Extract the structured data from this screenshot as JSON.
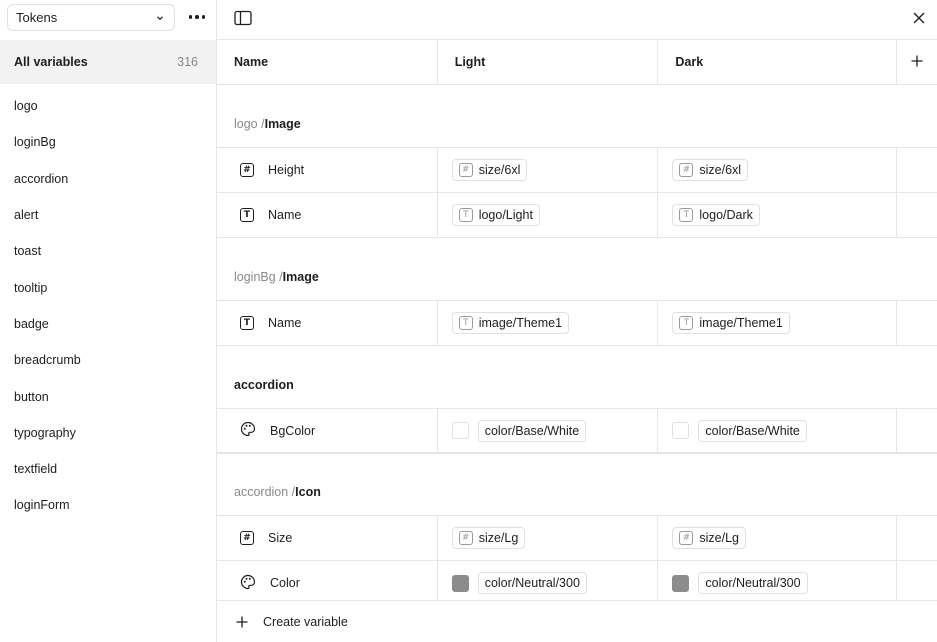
{
  "sidebar": {
    "collection": "Tokens",
    "all_variables": {
      "label": "All variables",
      "count": "316"
    },
    "groups": [
      "logo",
      "loginBg",
      "accordion",
      "alert",
      "toast",
      "tooltip",
      "badge",
      "breadcrumb",
      "button",
      "typography",
      "textfield",
      "loginForm"
    ]
  },
  "table": {
    "headers": {
      "name": "Name",
      "light": "Light",
      "dark": "Dark"
    },
    "sections": [
      {
        "path": "logo / ",
        "leaf": "Image",
        "rows": [
          {
            "type": "number",
            "name": "Height",
            "light": "size/6xl",
            "dark": "size/6xl"
          },
          {
            "type": "string",
            "name": "Name",
            "light": "logo/Light",
            "dark": "logo/Dark"
          }
        ]
      },
      {
        "path": "loginBg / ",
        "leaf": "Image",
        "rows": [
          {
            "type": "string",
            "name": "Name",
            "light": "image/Theme1",
            "dark": "image/Theme1"
          }
        ]
      },
      {
        "path": "",
        "leaf": "accordion",
        "rows": [
          {
            "type": "color",
            "name": "BgColor",
            "light": "color/Base/White",
            "dark": "color/Base/White",
            "swatch": "#FFFFFF"
          }
        ]
      },
      {
        "path": "accordion / ",
        "leaf": "Icon",
        "rows": [
          {
            "type": "number",
            "name": "Size",
            "light": "size/Lg",
            "dark": "size/Lg"
          },
          {
            "type": "color",
            "name": "Color",
            "light": "color/Neutral/300",
            "dark": "color/Neutral/300",
            "swatch": "#8C8C8C"
          }
        ]
      }
    ]
  },
  "footer": {
    "create_label": "Create variable"
  },
  "icons": {
    "collection_dropdown": "chevron-down-icon",
    "more": "more-horizontal-icon",
    "sidebar_toggle": "sidebar-toggle-icon",
    "close": "close-icon",
    "add_mode": "plus-icon",
    "number_type": "number-variable-icon",
    "string_type": "string-variable-icon",
    "color_type": "palette-icon"
  }
}
